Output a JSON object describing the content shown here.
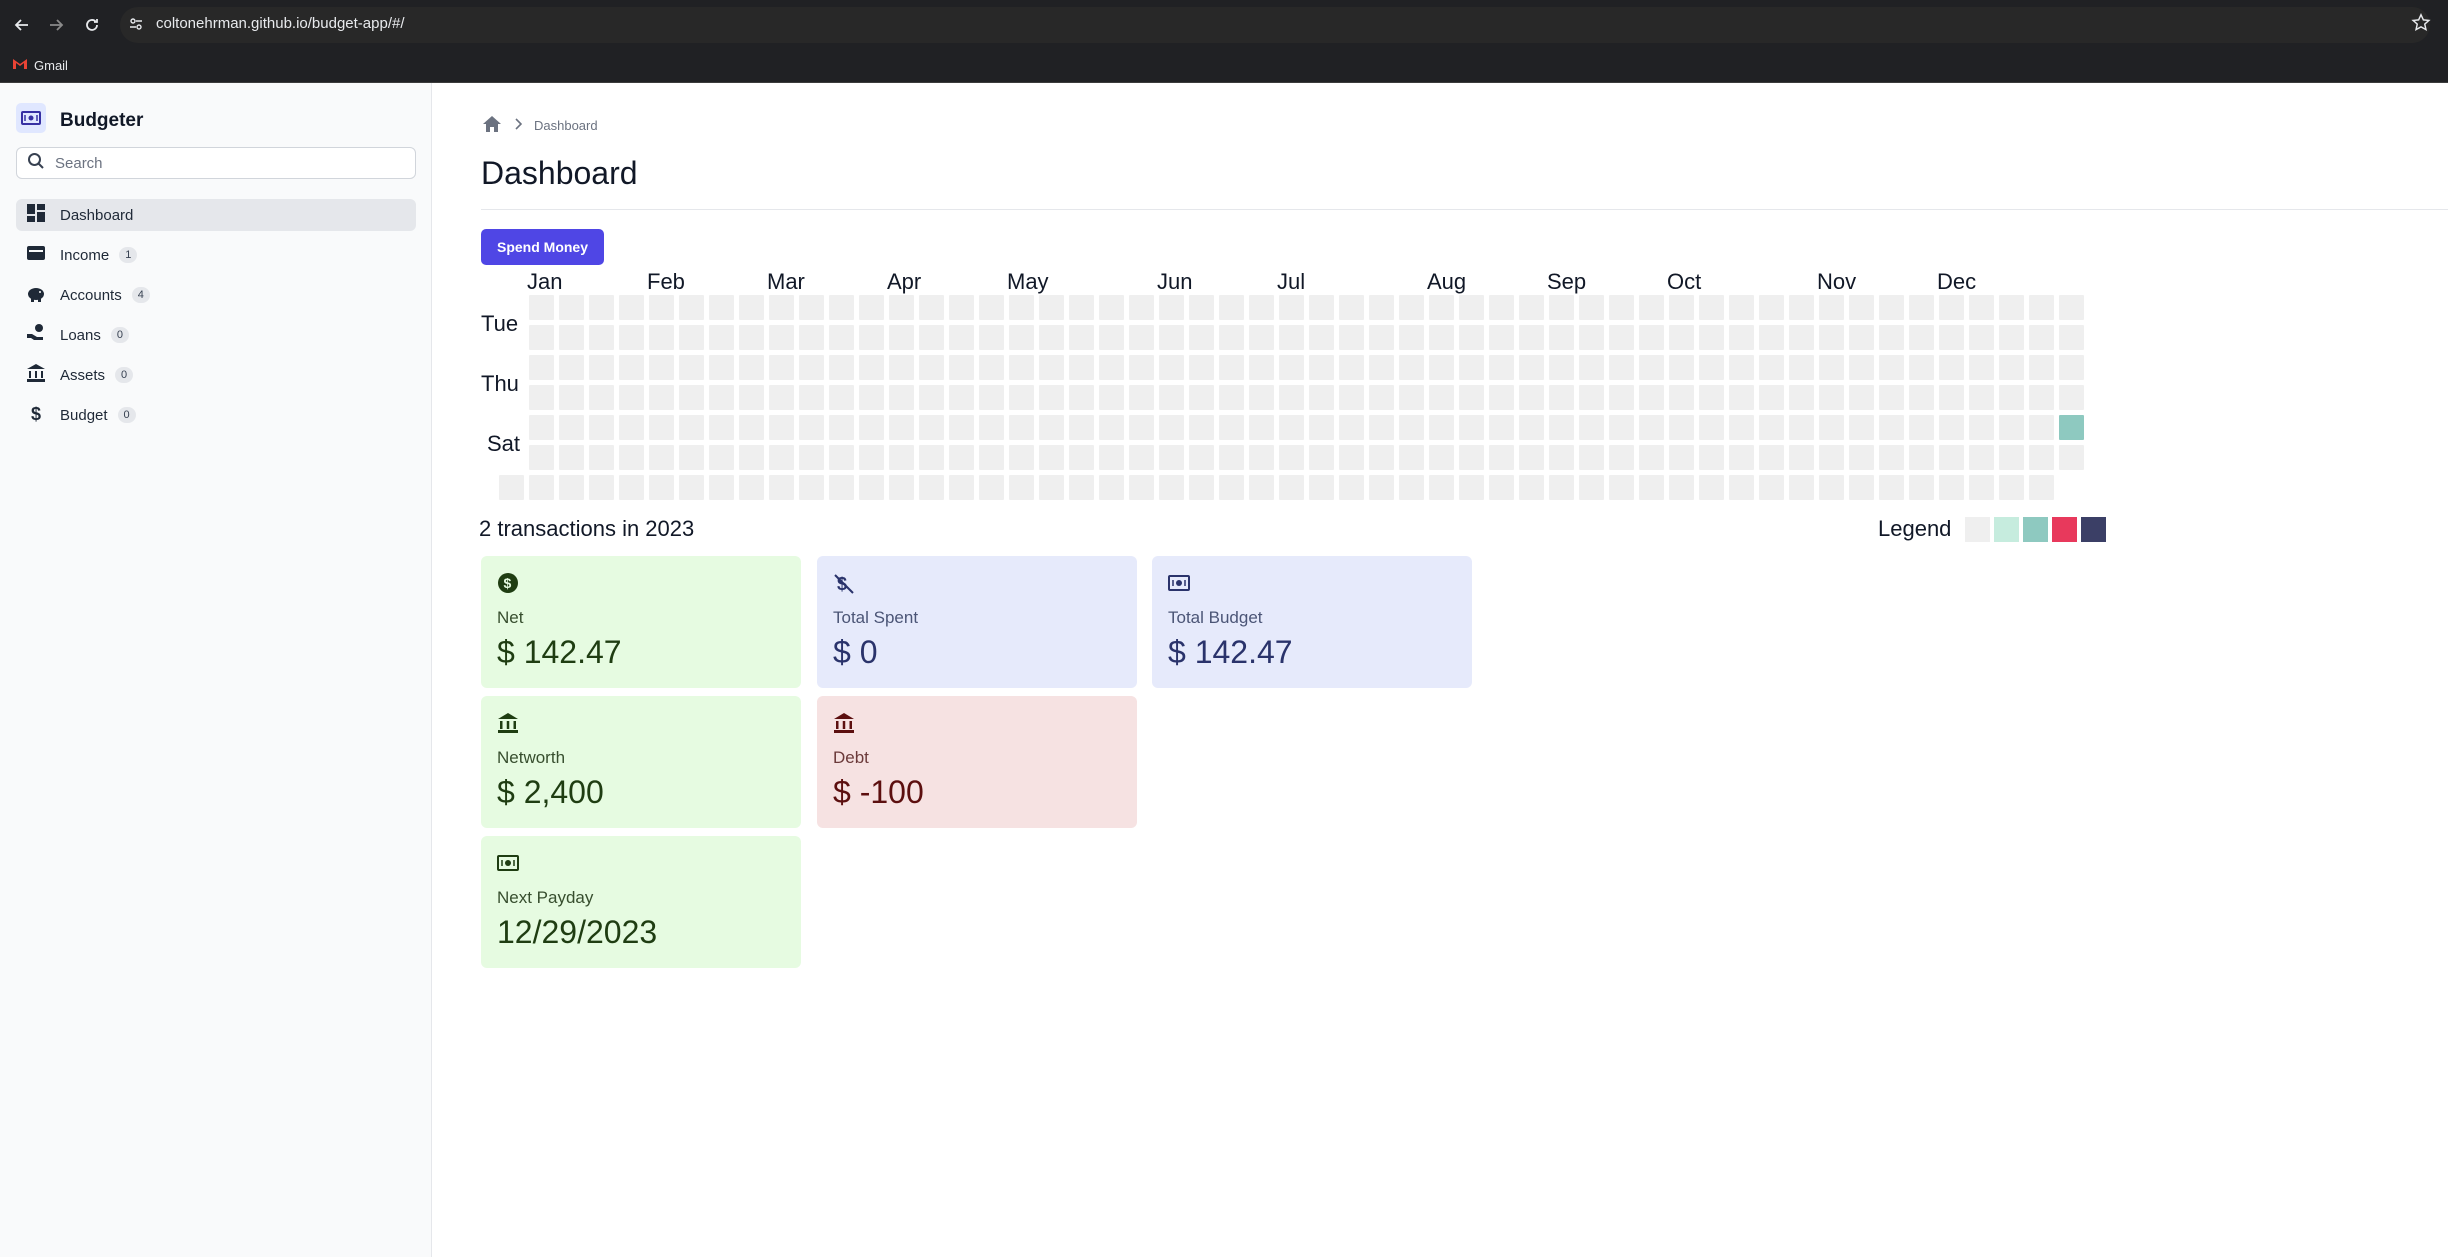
{
  "browser": {
    "url": "coltonehrman.github.io/budget-app/#/",
    "bookmarks": [
      {
        "label": "Gmail"
      }
    ]
  },
  "sidebar": {
    "brand": "Budgeter",
    "search_placeholder": "Search",
    "items": [
      {
        "label": "Dashboard",
        "badge": null,
        "active": true
      },
      {
        "label": "Income",
        "badge": "1"
      },
      {
        "label": "Accounts",
        "badge": "4"
      },
      {
        "label": "Loans",
        "badge": "0"
      },
      {
        "label": "Assets",
        "badge": "0"
      },
      {
        "label": "Budget",
        "badge": "0"
      }
    ]
  },
  "breadcrumb": {
    "current": "Dashboard"
  },
  "page": {
    "title": "Dashboard",
    "spend_button": "Spend Money"
  },
  "heatmap": {
    "months": [
      "Jan",
      "Feb",
      "Mar",
      "Apr",
      "May",
      "Jun",
      "Jul",
      "Aug",
      "Sep",
      "Oct",
      "Nov",
      "Dec"
    ],
    "day_labels": [
      "Tue",
      "Thu",
      "Sat"
    ],
    "summary": "2 transactions in 2023",
    "legend_label": "Legend",
    "legend_colors": [
      "#efefef",
      "#c6ecde",
      "#8ec9c0",
      "#e8395c",
      "#3b3f66"
    ],
    "empty_color": "#efefef",
    "active_cells": [
      {
        "week": 52,
        "day": 4,
        "level": 2
      }
    ]
  },
  "cards": {
    "net": {
      "label": "Net",
      "value": "$ 142.47"
    },
    "total_spent": {
      "label": "Total Spent",
      "value": "$ 0"
    },
    "total_budget": {
      "label": "Total Budget",
      "value": "$ 142.47"
    },
    "networth": {
      "label": "Networth",
      "value": "$ 2,400"
    },
    "debt": {
      "label": "Debt",
      "value": "$ -100"
    },
    "next_payday": {
      "label": "Next Payday",
      "value": "12/29/2023"
    }
  }
}
